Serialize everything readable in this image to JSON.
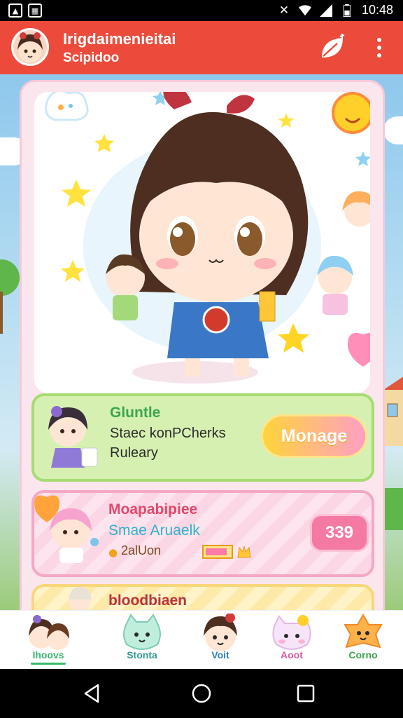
{
  "status_bar": {
    "time": "10:48",
    "icons": [
      "app-notification-icon",
      "gallery-notification-icon",
      "mute-icon",
      "wifi-icon",
      "signal-icon",
      "battery-icon"
    ]
  },
  "app_bar": {
    "title": "Irigdaimenieitai",
    "subtitle": "Scipidoo",
    "accent": "#ec4b3c",
    "actions": [
      "leaf-icon",
      "more-vert-icon"
    ]
  },
  "cards": [
    {
      "title": "Gluntle",
      "line1": "Staec konPCherks",
      "line2": "Ruleary",
      "button": "Monage",
      "title_color": "#3aa64f"
    },
    {
      "title": "Moapabipiee",
      "line1": "Smae Aruaelk",
      "line2": "2alUon",
      "button": "339",
      "title_color": "#e4476b",
      "line1_color": "#2fb3c9"
    },
    {
      "title": "bloodbiaen",
      "title_color": "#b8323c"
    }
  ],
  "bottom_nav": [
    {
      "label": "Ihoovs",
      "color": "#37b86c",
      "active": true
    },
    {
      "label": "Stonta",
      "color": "#2e9d8f"
    },
    {
      "label": "Voit",
      "color": "#2e7fbf"
    },
    {
      "label": "Aoot",
      "color": "#d95aa0"
    },
    {
      "label": "Corno",
      "color": "#3aa64f"
    }
  ]
}
